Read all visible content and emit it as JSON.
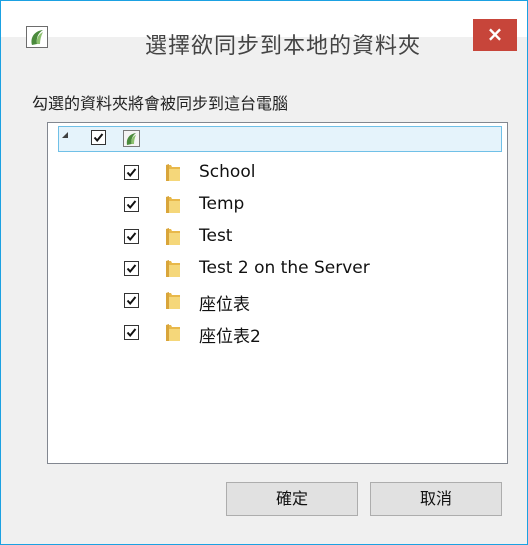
{
  "window": {
    "title": "選擇欲同步到本地的資料夾",
    "close_glyph": "×",
    "accent": "#1ba1e2",
    "close_color": "#c7453a"
  },
  "instruction": "勾選的資料夾將會被同步到這台電腦",
  "tree": {
    "root": {
      "checked": true,
      "icon": "app-logo-icon"
    },
    "items": [
      {
        "label": "School",
        "checked": true
      },
      {
        "label": "Temp",
        "checked": true
      },
      {
        "label": "Test",
        "checked": true
      },
      {
        "label": "Test 2 on the Server",
        "checked": true
      },
      {
        "label": "座位表",
        "checked": true
      },
      {
        "label": "座位表2",
        "checked": true
      }
    ]
  },
  "buttons": {
    "ok_label": "確定",
    "cancel_label": "取消"
  }
}
